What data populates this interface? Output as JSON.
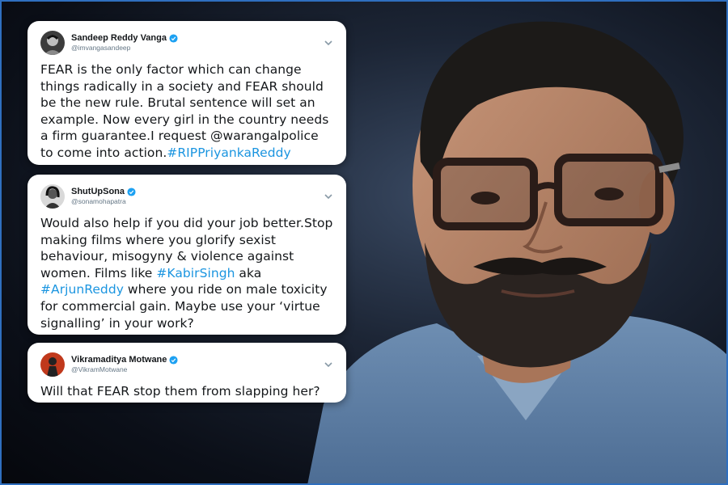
{
  "tweets": [
    {
      "name": "Sandeep Reddy Vanga",
      "handle": "@imvangasandeep",
      "text": "FEAR is the only factor which can change things radically in a society and FEAR should be the new rule. Brutal sentence will set an example. Now every girl in the country needs a firm guarantee.I request @warangalpolice to come into action.",
      "hashtag": "#RIPPriyankaReddy"
    },
    {
      "name": "ShutUpSona",
      "handle": "@sonamohapatra",
      "text_1": "Would also help if you did your job better.Stop making films where you glorify sexist behaviour, misogyny & violence against women. Films like ",
      "hashtag_1": "#KabirSingh",
      "text_2": " aka ",
      "hashtag_2": "#ArjunReddy",
      "text_3": " where you ride on male toxicity for commercial gain. Maybe use your ‘virtue signalling’ in your work?"
    },
    {
      "name": "Vikramaditya Motwane",
      "handle": "@VikramMotwane",
      "text": "Will that FEAR stop them from slapping her?"
    }
  ],
  "colors": {
    "verified": "#1da1f2",
    "hashtag": "#1b95e0",
    "frame": "#2f6fbf"
  },
  "icons": [
    "verified-badge-icon",
    "chevron-down-icon"
  ]
}
